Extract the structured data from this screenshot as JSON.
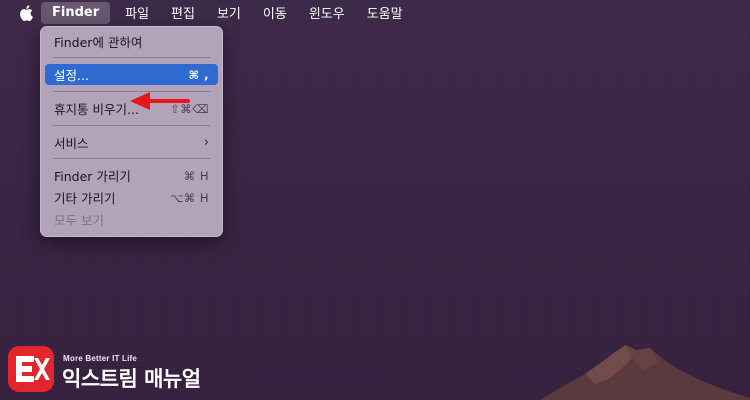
{
  "menubar": {
    "app_name": "Finder",
    "menus": [
      "파일",
      "편집",
      "보기",
      "이동",
      "윈도우",
      "도움말"
    ]
  },
  "dropdown": {
    "about": "Finder에 관하여",
    "settings": {
      "label": "설정...",
      "shortcut": "⌘ ,"
    },
    "empty_trash": {
      "label": "휴지통 비우기...",
      "shortcut": "⇧⌘⌫"
    },
    "services": {
      "label": "서비스",
      "chevron": "›"
    },
    "hide_finder": {
      "label": "Finder 가리기",
      "shortcut": "⌘ H"
    },
    "hide_others": {
      "label": "기타 가리기",
      "shortcut": "⌥⌘ H"
    },
    "show_all": "모두 보기"
  },
  "annotation": {
    "arrow_color": "#e8161b"
  },
  "watermark": {
    "tagline": "More Better IT Life",
    "name": "익스트림 매뉴얼",
    "badge_color": "#e3262c"
  },
  "colors": {
    "desktop": "#3b2545",
    "menubar": "#3d2a48",
    "menu_background": "#b2a3bb",
    "selection": "#2f6ad1"
  }
}
